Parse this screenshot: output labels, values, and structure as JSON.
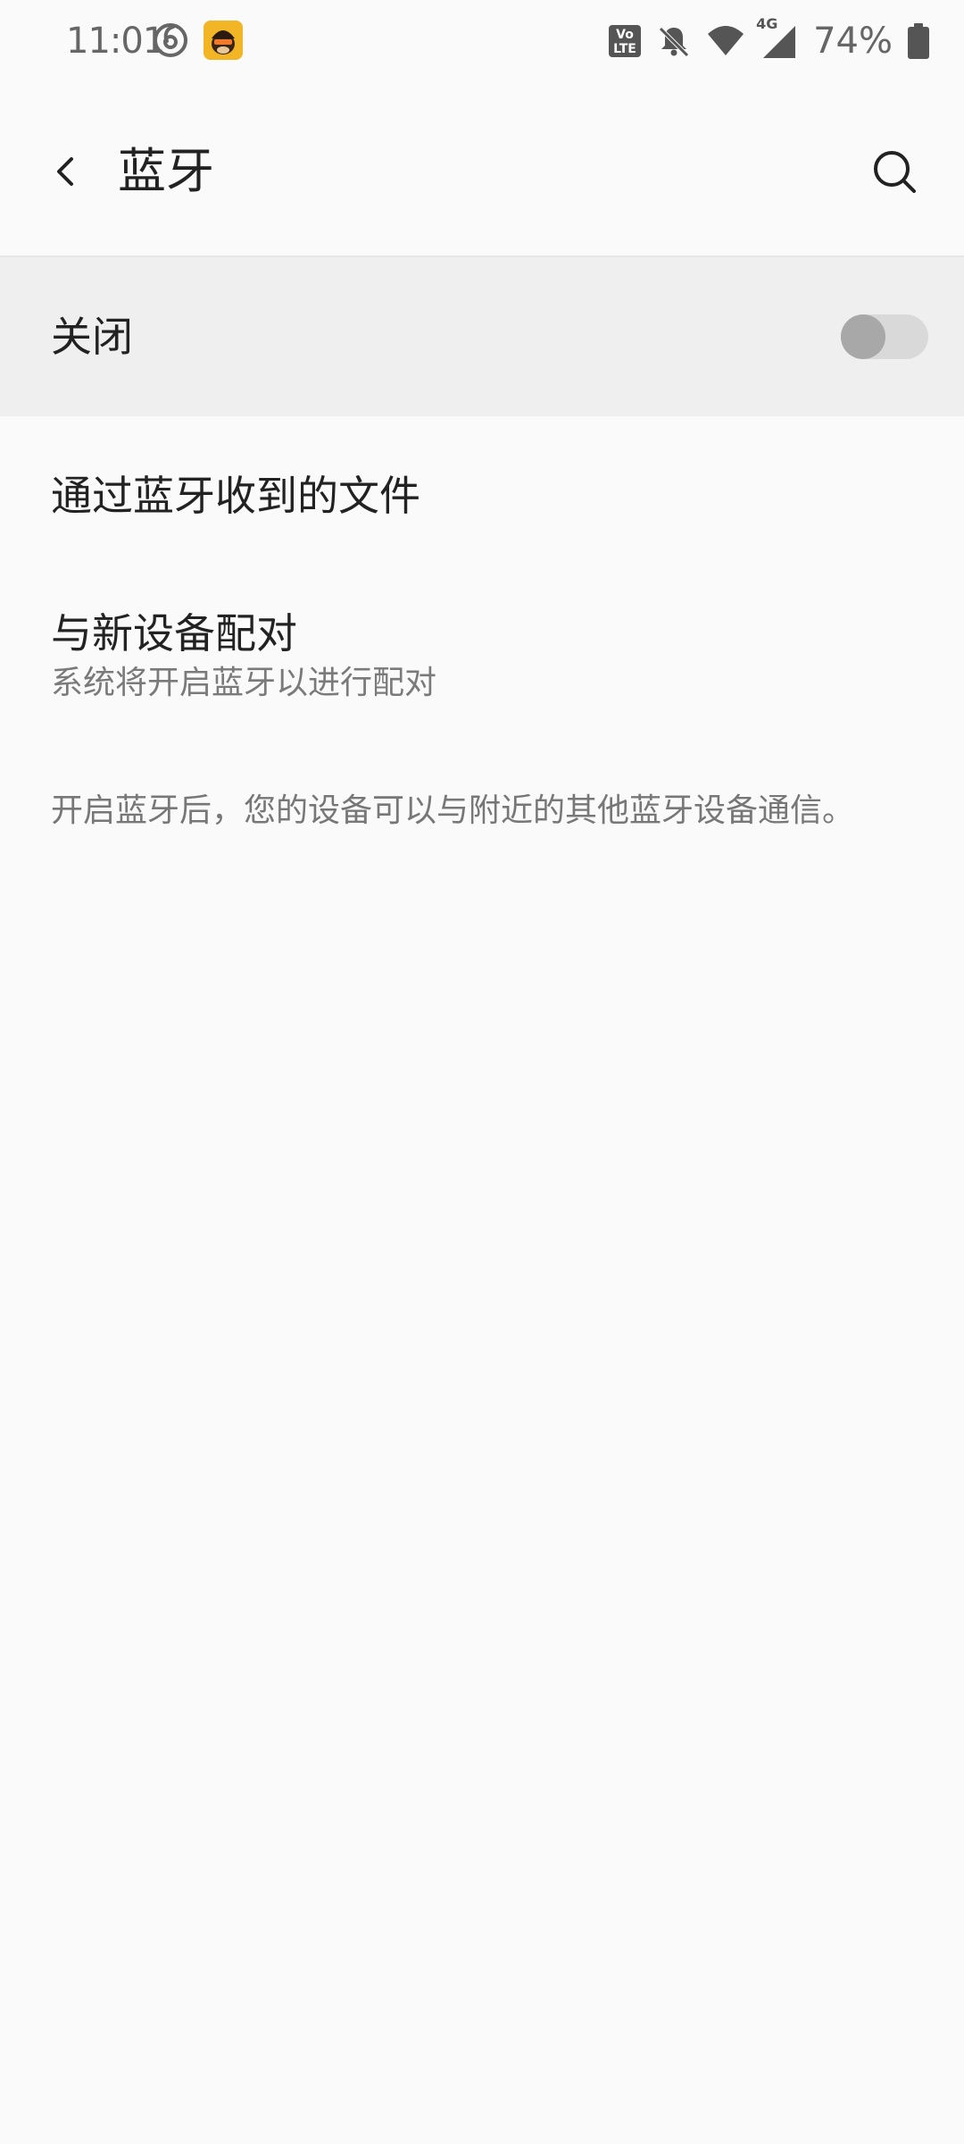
{
  "status_bar": {
    "time": "11:01",
    "battery_percent": "74%",
    "network_badge": "4G",
    "volte_badge_top": "Vo",
    "volte_badge_bottom": "LTE",
    "icons": [
      "netease-music-icon",
      "app-avatar-icon",
      "volte-icon",
      "notifications-off-icon",
      "wifi-icon",
      "cellular-signal-icon",
      "battery-icon"
    ]
  },
  "header": {
    "title": "蓝牙",
    "back_icon": "chevron-left-icon",
    "search_icon": "search-icon"
  },
  "bluetooth_toggle": {
    "label": "关闭",
    "enabled": false
  },
  "items": [
    {
      "title": "通过蓝牙收到的文件"
    },
    {
      "title": "与新设备配对",
      "subtitle": "系统将开启蓝牙以进行配对"
    }
  ],
  "footer_note": "开启蓝牙后，您的设备可以与附近的其他蓝牙设备通信。",
  "colors": {
    "background": "#fafafa",
    "toggle_row_background": "#efefef",
    "switch_track_off": "#d9d9d9",
    "switch_thumb_off": "#a8a8a8",
    "primary_text": "#222222",
    "secondary_text": "#7a7a7a"
  }
}
